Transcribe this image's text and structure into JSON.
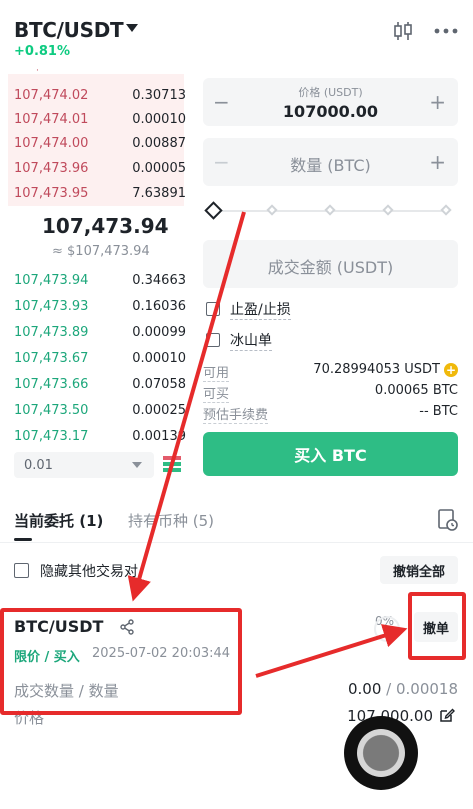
{
  "header": {
    "pair": "BTC/USDT",
    "change": "+0.81%",
    "chart_icon": "candlestick-icon",
    "more_icon": "more-icon"
  },
  "order_book": {
    "asks": [
      {
        "price": "107,474.02",
        "qty": "0.30713"
      },
      {
        "price": "107,474.01",
        "qty": "0.00010"
      },
      {
        "price": "107,474.00",
        "qty": "0.00887"
      },
      {
        "price": "107,473.96",
        "qty": "0.00005"
      },
      {
        "price": "107,473.95",
        "qty": "7.63891"
      }
    ],
    "last_price": "107,473.94",
    "last_price_fiat": "≈ $107,473.94",
    "bids": [
      {
        "price": "107,473.94",
        "qty": "0.34663"
      },
      {
        "price": "107,473.93",
        "qty": "0.16036"
      },
      {
        "price": "107,473.89",
        "qty": "0.00099"
      },
      {
        "price": "107,473.67",
        "qty": "0.00010"
      },
      {
        "price": "107,473.66",
        "qty": "0.07058"
      },
      {
        "price": "107,473.50",
        "qty": "0.00025"
      },
      {
        "price": "107,473.17",
        "qty": "0.00139"
      }
    ],
    "depth": "0.01"
  },
  "form": {
    "price_label": "价格 (USDT)",
    "price_value": "107000.00",
    "amount_placeholder": "数量 (BTC)",
    "total_placeholder": "成交金额 (USDT)",
    "tp_sl_label": "止盈/止损",
    "iceberg_label": "冰山单",
    "available_label": "可用",
    "available_value": "70.28994053 USDT",
    "max_buy_label": "可买",
    "max_buy_value": "0.00065 BTC",
    "fee_label": "预估手续费",
    "fee_value": "-- BTC",
    "buy_button": "买入 BTC"
  },
  "tabs": {
    "open_orders": "当前委托 (1)",
    "holdings": "持有币种 (5)"
  },
  "orders": {
    "hide_other_pairs": "隐藏其他交易对",
    "cancel_all": "撤销全部",
    "items": [
      {
        "pair": "BTC/USDT",
        "type": "限价 / 买入",
        "time": "2025-07-02 20:03:44",
        "progress": "0%",
        "cancel": "撤单",
        "filled_label": "成交数量 / 数量",
        "filled_done": "0.00",
        "filled_sep": " / ",
        "filled_total": "0.00018",
        "price_label": "价格",
        "price_value": "107,000.00"
      }
    ]
  },
  "colors": {
    "buy_green": "#2ebd85",
    "bid_text": "#1da77b",
    "ask_text": "#c04a5c",
    "annotation_red": "#e62b2b"
  }
}
